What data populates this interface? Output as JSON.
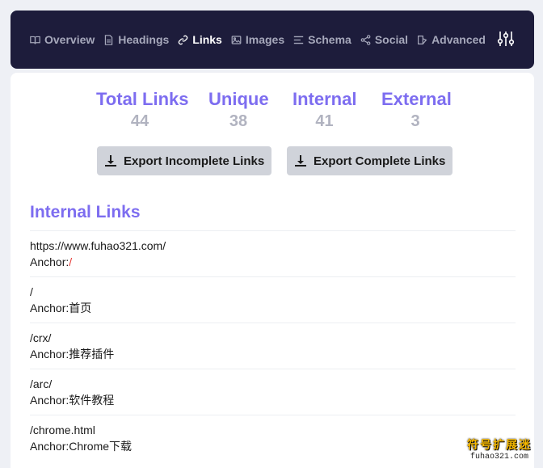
{
  "nav": {
    "items": [
      {
        "label": "Overview",
        "icon": "book-icon"
      },
      {
        "label": "Headings",
        "icon": "document-icon"
      },
      {
        "label": "Links",
        "icon": "link-icon"
      },
      {
        "label": "Images",
        "icon": "image-icon"
      },
      {
        "label": "Schema",
        "icon": "list-icon"
      },
      {
        "label": "Social",
        "icon": "share-icon"
      },
      {
        "label": "Advanced",
        "icon": "advanced-icon"
      }
    ],
    "active": "Links",
    "settings_icon": "sliders-icon"
  },
  "stats": [
    {
      "label": "Total Links",
      "value": "44"
    },
    {
      "label": "Unique",
      "value": "38"
    },
    {
      "label": "Internal",
      "value": "41"
    },
    {
      "label": "External",
      "value": "3"
    }
  ],
  "buttons": {
    "export_incomplete": "Export Incomplete Links",
    "export_complete": "Export Complete Links"
  },
  "section": {
    "title": "Internal Links"
  },
  "links": [
    {
      "url": "https://www.fuhao321.com/",
      "anchor_label": "Anchor:",
      "anchor": "/"
    },
    {
      "url": "/",
      "anchor_label": "Anchor:",
      "anchor": "首页"
    },
    {
      "url": "/crx/",
      "anchor_label": "Anchor:",
      "anchor": "推荐插件"
    },
    {
      "url": "/arc/",
      "anchor_label": "Anchor:",
      "anchor": "软件教程"
    },
    {
      "url": "/chrome.html",
      "anchor_label": "Anchor:",
      "anchor": "Chrome下载"
    }
  ],
  "watermark": {
    "title": "符号扩展迷",
    "url": "fuhao321.com"
  },
  "colors": {
    "nav_bg": "#1d1c3b",
    "accent": "#7d6df0",
    "stat_value": "#b1b3c0",
    "button_bg": "#d0d3da",
    "anchor_red": "#e53935"
  }
}
